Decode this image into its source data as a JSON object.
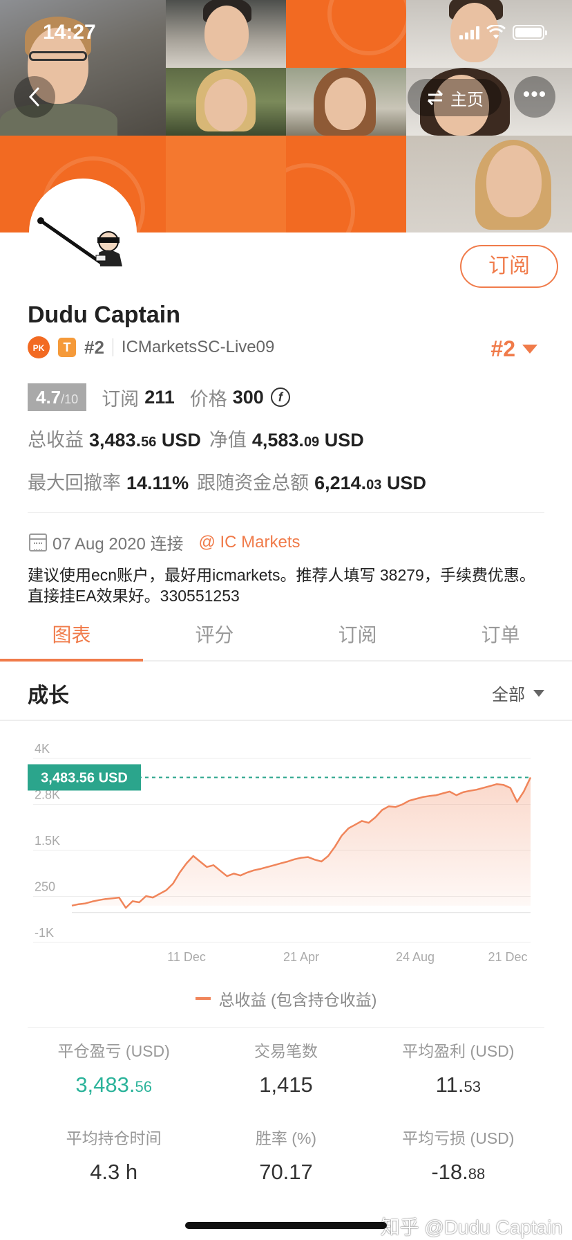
{
  "status_bar": {
    "time": "14:27"
  },
  "header": {
    "home_label": "主页",
    "back_icon": "chevron-left-icon",
    "more_label": "•••"
  },
  "profile": {
    "name": "Dudu Captain",
    "subscribe_label": "订阅",
    "pk_label": "PK",
    "tier_label": "T",
    "rank_small": "#2",
    "account": "ICMarketsSC-Live09",
    "rank_big": "#2",
    "rating": "4.7",
    "rating_max": "/10",
    "subs_label": "订阅",
    "subs_value": "211",
    "price_label": "价格",
    "price_value": "300",
    "total_profit_label": "总收益",
    "total_profit_int": "3,483.",
    "total_profit_dec": "56",
    "total_profit_unit": "USD",
    "equity_label": "净值",
    "equity_int": "4,583.",
    "equity_dec": "09",
    "equity_unit": "USD",
    "drawdown_label": "最大回撤率",
    "drawdown_value": "14.11%",
    "follow_label": "跟随资金总额",
    "follow_int": "6,214.",
    "follow_dec": "03",
    "follow_unit": "USD",
    "connect_date": "07 Aug 2020 连接",
    "broker": "@ IC Markets",
    "description": "建议使用ecn账户，最好用icmarkets。推荐人填写 38279，手续费优惠。直接挂EA效果好。330551253"
  },
  "tabs": [
    "图表",
    "评分",
    "订阅",
    "订单"
  ],
  "section": {
    "title": "成长",
    "filter": "全部"
  },
  "chart_data": {
    "type": "area",
    "y_ticks": [
      "4K",
      "2.8K",
      "1.5K",
      "250",
      "-1K"
    ],
    "y_tick_values": [
      4000,
      2750,
      1500,
      250,
      -1000
    ],
    "x_ticks": [
      "11 Dec",
      "21 Apr",
      "24 Aug",
      "21 Dec"
    ],
    "ylim": [
      -1000,
      4000
    ],
    "current_label": "3,483.56 USD",
    "current_value": 3483.56,
    "legend": "总收益 (包含持仓收益)",
    "series": [
      {
        "values": [
          0,
          40,
          60,
          110,
          150,
          180,
          200,
          220,
          -60,
          120,
          90,
          260,
          220,
          320,
          420,
          600,
          900,
          1150,
          1350,
          1200,
          1050,
          1100,
          950,
          800,
          870,
          820,
          900,
          960,
          1000,
          1050,
          1100,
          1150,
          1200,
          1260,
          1300,
          1320,
          1250,
          1200,
          1350,
          1600,
          1900,
          2100,
          2200,
          2300,
          2250,
          2400,
          2600,
          2700,
          2680,
          2750,
          2850,
          2900,
          2950,
          2980,
          3000,
          3050,
          3100,
          3000,
          3080,
          3120,
          3150,
          3200,
          3250,
          3300,
          3280,
          3200,
          2820,
          3100,
          3483.56
        ],
        "color": "#f0855a"
      }
    ]
  },
  "metrics": [
    {
      "label": "平仓盈亏 (USD)",
      "int": "3,483.",
      "dec": "56",
      "green": true
    },
    {
      "label": "交易笔数",
      "int": "1,415",
      "dec": ""
    },
    {
      "label": "平均盈利 (USD)",
      "int": "11.",
      "dec": "53"
    },
    {
      "label": "平均持仓时间",
      "int": "4.3 h",
      "dec": ""
    },
    {
      "label": "胜率 (%)",
      "int": "70.17",
      "dec": ""
    },
    {
      "label": "平均亏损 (USD)",
      "int": "-18.",
      "dec": "88"
    }
  ],
  "watermark": "知乎 @Dudu Captain",
  "colors": {
    "accent": "#f07b4a",
    "banner": "#f26a22",
    "profit_green": "#2bb39a",
    "chart_label_bg": "#2ba58c"
  }
}
